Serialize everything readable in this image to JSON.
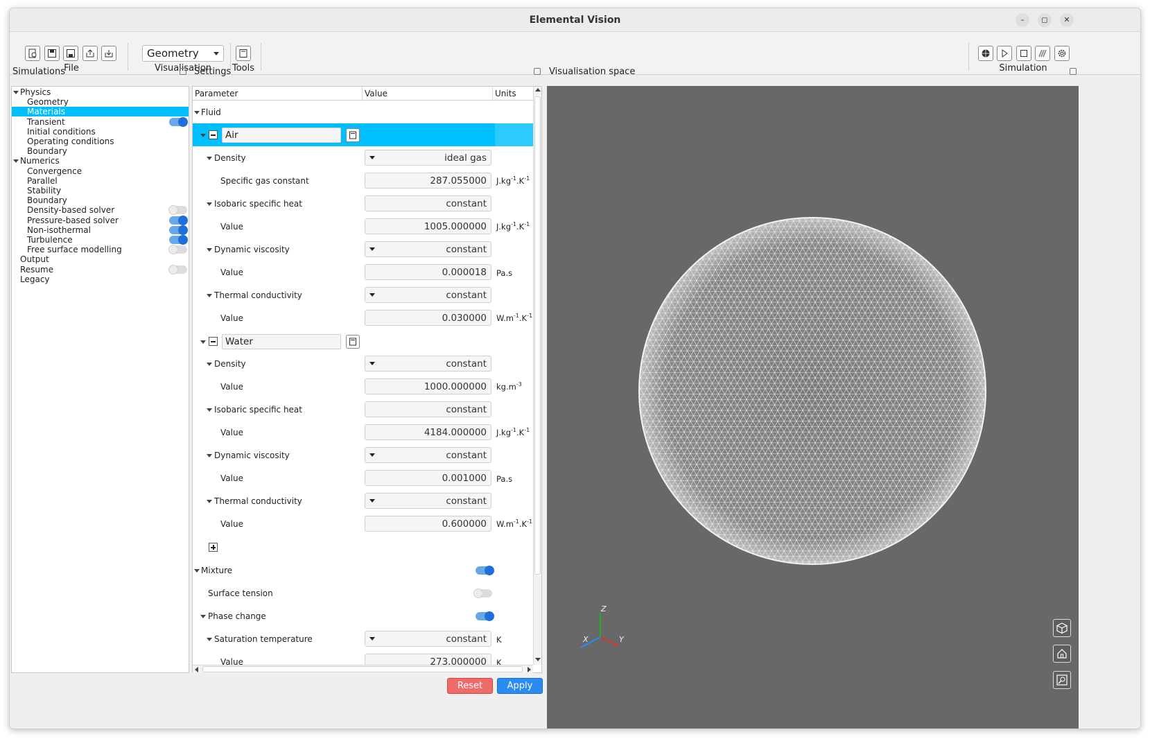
{
  "window": {
    "title": "Elemental Vision",
    "minimize_icon": "minimize-icon",
    "maximize_icon": "maximize-icon",
    "close_icon": "close-icon"
  },
  "toolbar": {
    "file_label": "File",
    "visualisation_label": "Visualisation",
    "visualisation_selected": "Geometry",
    "tools_label": "Tools",
    "simulation_label": "Simulation"
  },
  "simulations": {
    "title": "Simulations",
    "items": [
      {
        "label": "Physics",
        "level": 0,
        "expanded": true
      },
      {
        "label": "Geometry",
        "level": 1
      },
      {
        "label": "Materials",
        "level": 1,
        "selected": true
      },
      {
        "label": "Transient",
        "level": 1,
        "toggle": "on"
      },
      {
        "label": "Initial conditions",
        "level": 1
      },
      {
        "label": "Operating conditions",
        "level": 1
      },
      {
        "label": "Boundary",
        "level": 1
      },
      {
        "label": "Numerics",
        "level": 0,
        "expanded": true
      },
      {
        "label": "Convergence",
        "level": 1
      },
      {
        "label": "Parallel",
        "level": 1
      },
      {
        "label": "Stability",
        "level": 1
      },
      {
        "label": "Boundary",
        "level": 1
      },
      {
        "label": "Density-based solver",
        "level": 1,
        "toggle": "off"
      },
      {
        "label": "Pressure-based solver",
        "level": 1,
        "toggle": "on"
      },
      {
        "label": "Non-isothermal",
        "level": 1,
        "toggle": "on"
      },
      {
        "label": "Turbulence",
        "level": 1,
        "toggle": "on"
      },
      {
        "label": "Free surface modelling",
        "level": 1,
        "toggle": "off"
      },
      {
        "label": "Output",
        "level": 0
      },
      {
        "label": "Resume",
        "level": 0,
        "toggle": "off"
      },
      {
        "label": "Legacy",
        "level": 0
      }
    ]
  },
  "settings": {
    "title": "Settings",
    "columns": [
      "Parameter",
      "Value",
      "Units"
    ],
    "fluid_label": "Fluid",
    "air": {
      "name": "Air",
      "density": {
        "label": "Density",
        "value": "ideal gas"
      },
      "gas_constant": {
        "label": "Specific gas constant",
        "value": "287.055000",
        "unit": "J.kg",
        "sup1": "-1",
        "mid": ".K",
        "sup2": "-1"
      },
      "heat": {
        "label": "Isobaric specific heat",
        "value": "constant"
      },
      "heat_value": {
        "label": "Value",
        "value": "1005.000000",
        "unit": "J.kg",
        "sup1": "-1",
        "mid": ".K",
        "sup2": "-1"
      },
      "visc": {
        "label": "Dynamic viscosity",
        "value": "constant"
      },
      "visc_value": {
        "label": "Value",
        "value": "0.000018",
        "unit": "Pa.s"
      },
      "cond": {
        "label": "Thermal conductivity",
        "value": "constant"
      },
      "cond_value": {
        "label": "Value",
        "value": "0.030000",
        "unit": "W.m",
        "sup1": "-1",
        "mid": ".K",
        "sup2": "-1"
      }
    },
    "water": {
      "name": "Water",
      "density": {
        "label": "Density",
        "value": "constant"
      },
      "density_value": {
        "label": "Value",
        "value": "1000.000000",
        "unit": "kg.m",
        "sup1": "-3"
      },
      "heat": {
        "label": "Isobaric specific heat",
        "value": "constant"
      },
      "heat_value": {
        "label": "Value",
        "value": "4184.000000",
        "unit": "J.kg",
        "sup1": "-1",
        "mid": ".K",
        "sup2": "-1"
      },
      "visc": {
        "label": "Dynamic viscosity",
        "value": "constant"
      },
      "visc_value": {
        "label": "Value",
        "value": "0.001000",
        "unit": "Pa.s"
      },
      "cond": {
        "label": "Thermal conductivity",
        "value": "constant"
      },
      "cond_value": {
        "label": "Value",
        "value": "0.600000",
        "unit": "W.m",
        "sup1": "-1",
        "mid": ".K",
        "sup2": "-1"
      }
    },
    "mixture_label": "Mixture",
    "surface_tension_label": "Surface tension",
    "phase_change_label": "Phase change",
    "sat_temp": {
      "label": "Saturation temperature",
      "value": "constant",
      "unit": "K"
    },
    "sat_value": {
      "label": "Value",
      "value": "273.000000",
      "unit": "K"
    },
    "reset_label": "Reset",
    "apply_label": "Apply"
  },
  "viz": {
    "title": "Visualisation space",
    "axis_x": "X",
    "axis_y": "Y",
    "axis_z": "Z",
    "colors": {
      "background": "#686868",
      "mesh": "#f2f2f2",
      "x_axis": "#1e90ff",
      "y_axis": "#e03030",
      "z_axis": "#20b020"
    }
  }
}
